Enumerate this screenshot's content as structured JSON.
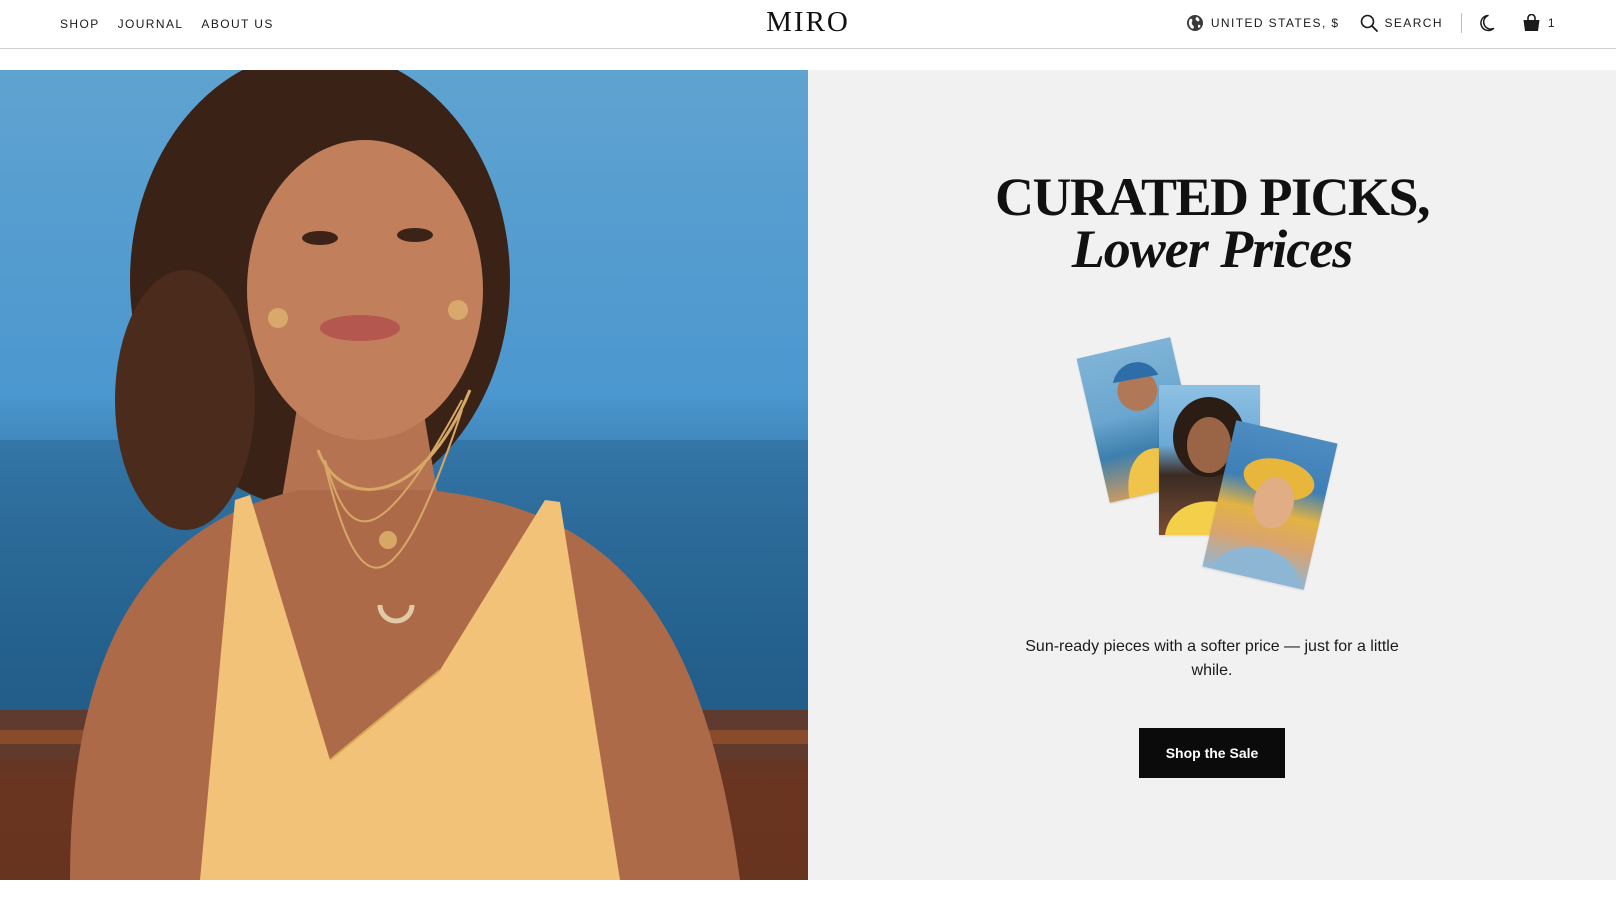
{
  "header": {
    "nav_left": [
      "SHOP",
      "JOURNAL",
      "ABOUT US"
    ],
    "logo": "MIRO",
    "region_label": "UNITED STATES, $",
    "search_label": "SEARCH",
    "cart_count": "1",
    "icons": {
      "region": "globe-icon",
      "search": "search-icon",
      "theme": "moon-icon",
      "cart": "shopping-bag-icon"
    }
  },
  "hero": {
    "headline_line1": "CURATED PICKS,",
    "headline_line2": "Lower Prices",
    "subtext": "Sun-ready pieces with a softer price — just for a little while.",
    "cta_label": "Shop the Sale"
  },
  "colors": {
    "panel_bg": "#f1f1f1",
    "cta_bg": "#0b0b0b",
    "text": "#111111"
  }
}
